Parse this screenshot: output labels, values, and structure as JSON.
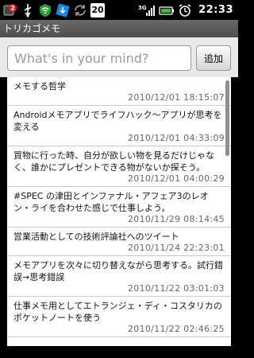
{
  "status_bar": {
    "notification_count": "2",
    "calendar_day": "20",
    "network_label": "3G",
    "time": "22:33",
    "icons": [
      "notification-badge-icon",
      "usb-icon",
      "shield-icon",
      "download-icon",
      "sync-icon",
      "calendar-icon",
      "signal-icon",
      "battery-icon",
      "alarm-icon"
    ]
  },
  "app": {
    "title": "トリカゴメモ"
  },
  "composer": {
    "placeholder": "What's in your mind?",
    "value": "",
    "add_label": "追加"
  },
  "memos": [
    {
      "text": "メモする哲学",
      "date": "2010/12/01 18:15:07"
    },
    {
      "text": "Androidメモアプリでライフハック～アプリが思考を変える",
      "date": "2010/12/01 04:33:09"
    },
    {
      "text": "買物に行った時、自分が欲しい物を見るだけじゃなく、誰かにプレゼントできる物がないか探そう。",
      "date": "2010/12/01 04:00:29"
    },
    {
      "text": "#SPEC の津田とインファナル・アフェア3のレオン・ライを合わせた感じで仕事しよう。",
      "date": "2010/11/29 08:14:45"
    },
    {
      "text": "営業活動としての技術評論社へのツイート",
      "date": "2010/11/24 22:23:01"
    },
    {
      "text": "メモアプリを次々に切り替えながら思考する。試行錯誤→思考錯誤",
      "date": "2010/11/22 03:01:03"
    },
    {
      "text": "仕事メモ用としてエトランジェ・ディ・コスタリカのポケットノートを使う",
      "date": "2010/11/22 02:46:25"
    }
  ],
  "colors": {
    "titlebar": "#5a5a5a",
    "input_area_bg": "#e9e9e9",
    "list_bg": "#ffffff",
    "date_text": "#666666"
  }
}
